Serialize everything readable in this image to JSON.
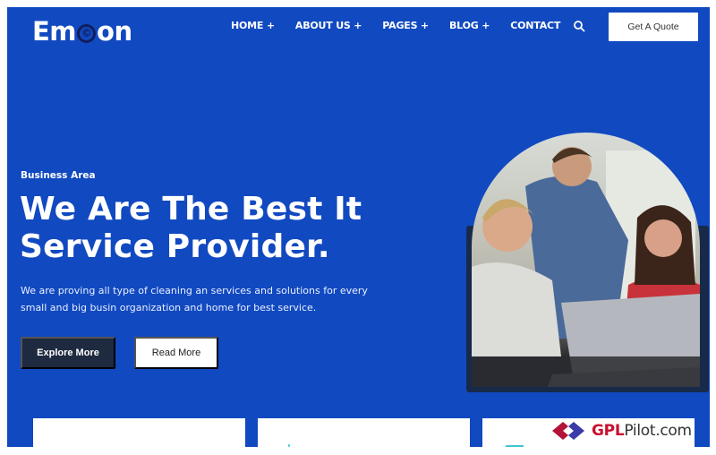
{
  "header": {
    "logo": {
      "prefix": "Em",
      "mark": "©",
      "suffix": "on"
    },
    "nav": [
      {
        "label": "HOME +"
      },
      {
        "label": "ABOUT US +"
      },
      {
        "label": "PAGES +"
      },
      {
        "label": "BLOG +"
      },
      {
        "label": "CONTACT"
      }
    ],
    "search_icon": "search-icon",
    "cta_label": "Get A Quote"
  },
  "hero": {
    "eyebrow": "Business Area",
    "headline_line1": "We Are The Best It",
    "headline_line2": "Service Provider.",
    "description": "We are proving all type of cleaning an services and solutions for every small and big busin organization and home for best service.",
    "primary_button": "Explore More",
    "secondary_button": "Read More",
    "image_alt": "three people looking at a laptop"
  },
  "cards": [
    {
      "icon": "gear-icon"
    },
    {
      "icon": "globe-icon"
    },
    {
      "icon": "monitor-icon"
    }
  ],
  "watermark": {
    "brand": "GPL",
    "rest": "Pilot.com"
  },
  "colors": {
    "primary_blue": "#1149c0",
    "dark_button": "#1e2a3f",
    "icon_teal": "#3cc6d6",
    "watermark_red": "#c8102e"
  }
}
